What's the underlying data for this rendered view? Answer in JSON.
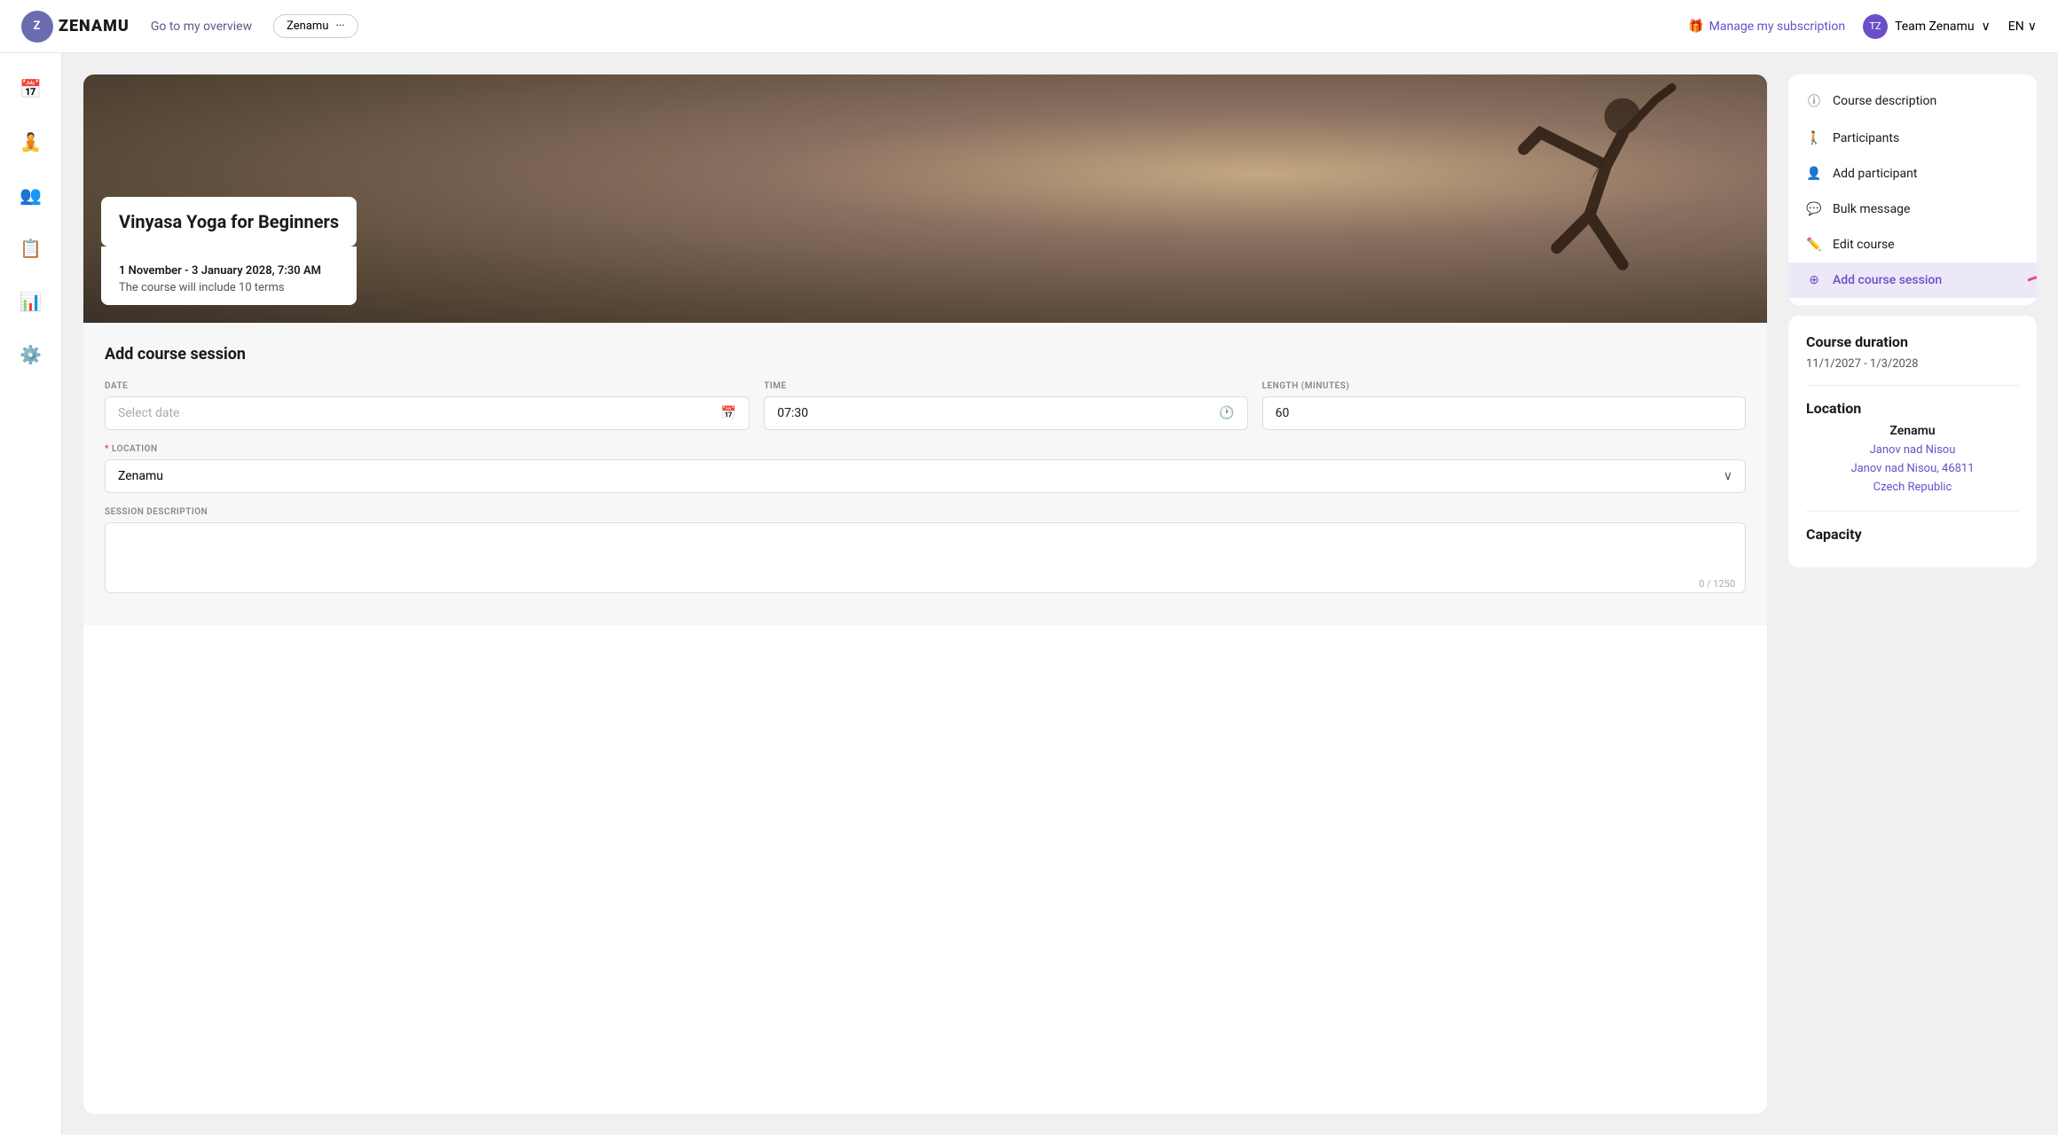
{
  "app": {
    "logo_text": "ZENAMU",
    "nav_link": "Go to my overview",
    "nav_pill_label": "Zenamu",
    "manage_subscription": "Manage my subscription",
    "team_name": "Team Zenamu",
    "language": "EN"
  },
  "sidebar": {
    "icons": [
      {
        "name": "calendar-icon",
        "symbol": "📅"
      },
      {
        "name": "person-icon",
        "symbol": "🧘"
      },
      {
        "name": "group-icon",
        "symbol": "👥"
      },
      {
        "name": "clipboard-icon",
        "symbol": "📋"
      },
      {
        "name": "chart-icon",
        "symbol": "📊"
      },
      {
        "name": "settings-icon",
        "symbol": "⚙️"
      }
    ]
  },
  "hero": {
    "title": "Vinyasa Yoga for Beginners",
    "date_range": "1 November - 3 January 2028, 7:30 AM",
    "subtitle": "The course will include 10 terms"
  },
  "right_menu": {
    "items": [
      {
        "label": "Course description",
        "icon": "ⓘ"
      },
      {
        "label": "Participants",
        "icon": "🚶"
      },
      {
        "label": "Add participant",
        "icon": "👤"
      },
      {
        "label": "Bulk message",
        "icon": "💬"
      },
      {
        "label": "Edit course",
        "icon": "✏️"
      },
      {
        "label": "Add course session",
        "icon": "⊕",
        "active": true
      }
    ]
  },
  "course_info": {
    "duration_title": "Course duration",
    "dates": "11/1/2027 - 1/3/2028",
    "location_title": "Location",
    "location_name": "Zenamu",
    "location_city": "Janov nad Nisou",
    "location_address": "Janov nad Nisou, 46811",
    "location_country": "Czech Republic",
    "capacity_title": "Capacity"
  },
  "form": {
    "title": "Add course session",
    "date_label": "DATE",
    "date_placeholder": "Select date",
    "time_label": "TIME",
    "time_value": "07:30",
    "length_label": "LENGTH (MINUTES)",
    "length_value": "60",
    "location_label": "LOCATION",
    "location_value": "Zenamu",
    "description_label": "SESSION DESCRIPTION",
    "description_placeholder": "",
    "char_count": "0 / 1250"
  }
}
